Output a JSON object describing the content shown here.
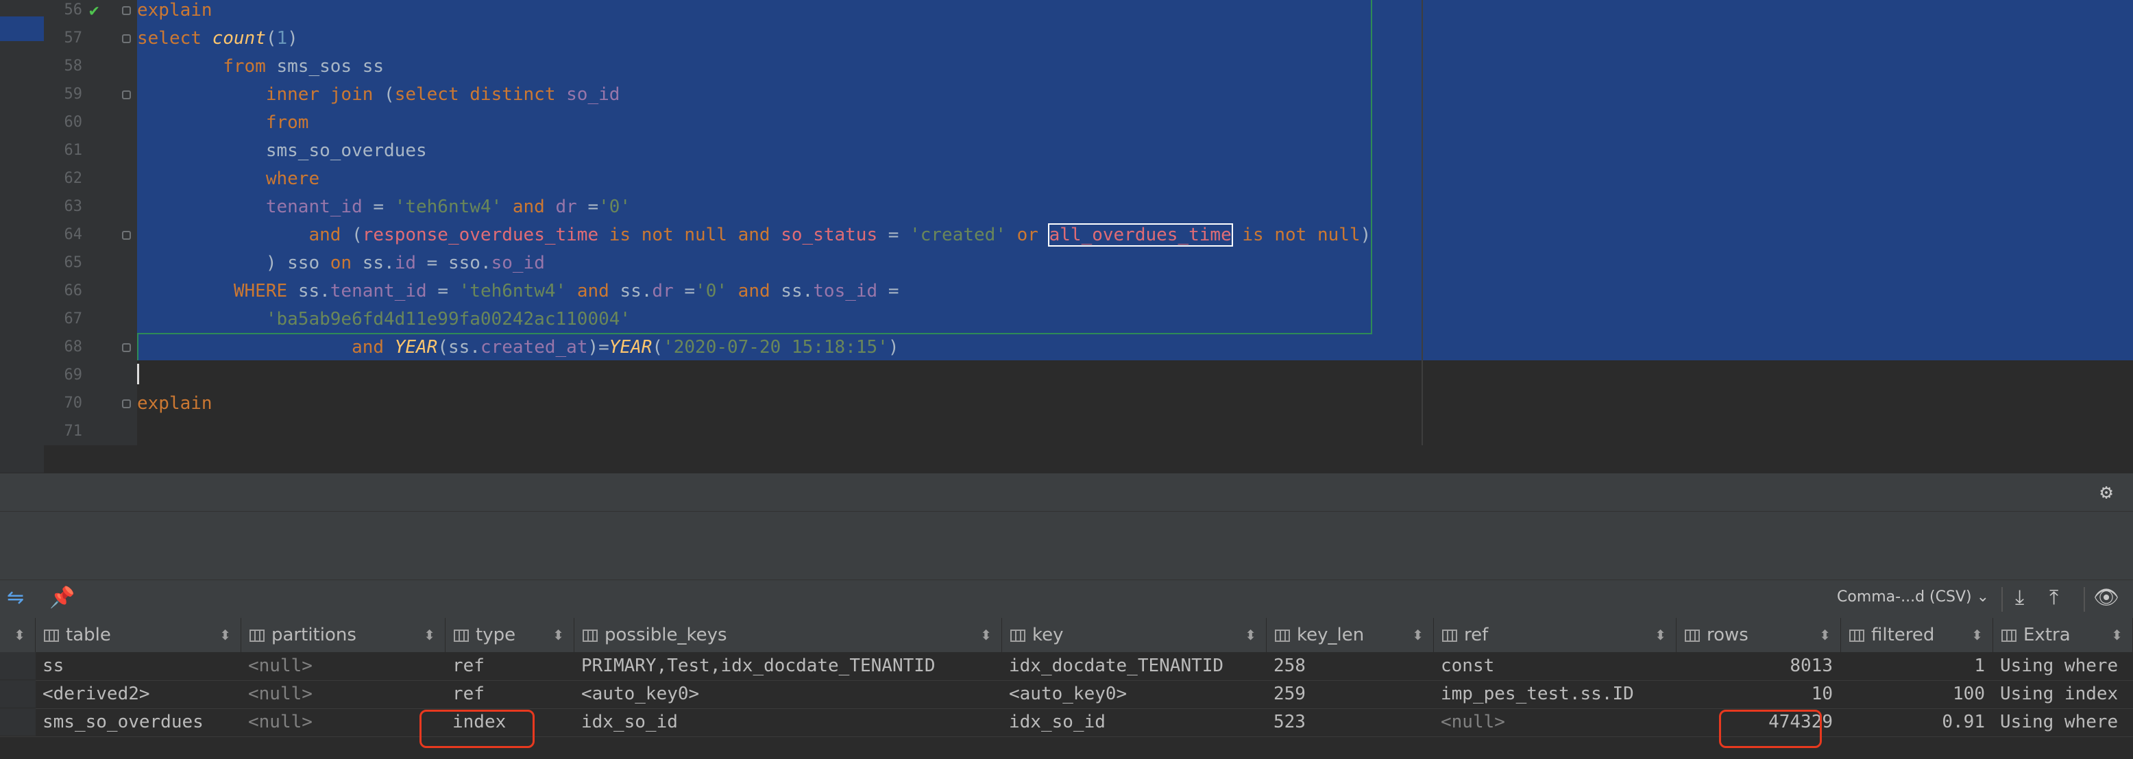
{
  "editor": {
    "line_numbers": [
      "56",
      "57",
      "58",
      "59",
      "60",
      "61",
      "62",
      "63",
      "64",
      "65",
      "66",
      "67",
      "68",
      "69",
      "70",
      "71"
    ],
    "lines": [
      [
        {
          "t": "explain",
          "c": "kw"
        }
      ],
      [
        {
          "t": "select ",
          "c": "kw"
        },
        {
          "t": "count",
          "c": "fn"
        },
        {
          "t": "(",
          "c": "plain"
        },
        {
          "t": "1",
          "c": "num"
        },
        {
          "t": ")",
          "c": "plain"
        }
      ],
      [
        {
          "t": "        from ",
          "c": "kw"
        },
        {
          "t": "sms_sos ss",
          "c": "plain"
        }
      ],
      [
        {
          "t": "            inner join ",
          "c": "kw"
        },
        {
          "t": "(",
          "c": "plain"
        },
        {
          "t": "select distinct ",
          "c": "kw"
        },
        {
          "t": "so_id",
          "c": "col"
        }
      ],
      [
        {
          "t": "            from",
          "c": "kw"
        }
      ],
      [
        {
          "t": "            sms_so_overdues",
          "c": "plain"
        }
      ],
      [
        {
          "t": "            where",
          "c": "kw"
        }
      ],
      [
        {
          "t": "            tenant_id ",
          "c": "col"
        },
        {
          "t": "= ",
          "c": "plain"
        },
        {
          "t": "'teh6ntw4' ",
          "c": "str"
        },
        {
          "t": "and ",
          "c": "kw"
        },
        {
          "t": "dr ",
          "c": "col"
        },
        {
          "t": "=",
          "c": "plain"
        },
        {
          "t": "'0'",
          "c": "str"
        }
      ],
      [
        {
          "t": "                and ",
          "c": "kw"
        },
        {
          "t": "(",
          "c": "plain"
        },
        {
          "t": "response_overdues_time ",
          "c": "err"
        },
        {
          "t": "is not null ",
          "c": "kw"
        },
        {
          "t": "and ",
          "c": "kw"
        },
        {
          "t": "so_status ",
          "c": "err"
        },
        {
          "t": "= ",
          "c": "plain"
        },
        {
          "t": "'created' ",
          "c": "str"
        },
        {
          "t": "or ",
          "c": "kw"
        },
        {
          "t": "all_overdues_time",
          "c": "err boxed"
        },
        {
          "t": " is not null",
          "c": "kw"
        },
        {
          "t": ")",
          "c": "plain"
        }
      ],
      [
        {
          "t": "            ) sso ",
          "c": "plain"
        },
        {
          "t": "on ",
          "c": "kw"
        },
        {
          "t": "ss.",
          "c": "plain"
        },
        {
          "t": "id ",
          "c": "col"
        },
        {
          "t": "= sso.",
          "c": "plain"
        },
        {
          "t": "so_id",
          "c": "col"
        }
      ],
      [
        {
          "t": "         WHERE ",
          "c": "kw"
        },
        {
          "t": "ss.",
          "c": "plain"
        },
        {
          "t": "tenant_id ",
          "c": "col"
        },
        {
          "t": "= ",
          "c": "plain"
        },
        {
          "t": "'teh6ntw4' ",
          "c": "str"
        },
        {
          "t": "and ",
          "c": "kw"
        },
        {
          "t": "ss.",
          "c": "plain"
        },
        {
          "t": "dr ",
          "c": "col"
        },
        {
          "t": "=",
          "c": "plain"
        },
        {
          "t": "'0' ",
          "c": "str"
        },
        {
          "t": "and ",
          "c": "kw"
        },
        {
          "t": "ss.",
          "c": "plain"
        },
        {
          "t": "tos_id ",
          "c": "col"
        },
        {
          "t": "=",
          "c": "plain"
        }
      ],
      [
        {
          "t": "            'ba5ab9e6fd4d11e99fa00242ac110004'",
          "c": "str"
        }
      ],
      [
        {
          "t": "                    and ",
          "c": "kw"
        },
        {
          "t": "YEAR",
          "c": "fn"
        },
        {
          "t": "(ss.",
          "c": "plain"
        },
        {
          "t": "created_at",
          "c": "col"
        },
        {
          "t": ")=",
          "c": "plain"
        },
        {
          "t": "YEAR",
          "c": "fn"
        },
        {
          "t": "(",
          "c": "plain"
        },
        {
          "t": "'2020-07-20 15:18:15'",
          "c": "str"
        },
        {
          "t": ")",
          "c": "plain"
        }
      ],
      [],
      [
        {
          "t": "explain",
          "c": "kw"
        }
      ],
      []
    ]
  },
  "toolbar": {
    "csv_label": "Comma-...d (CSV) ⌄"
  },
  "grid": {
    "columns": [
      {
        "label": "table"
      },
      {
        "label": "partitions"
      },
      {
        "label": "type"
      },
      {
        "label": "possible_keys"
      },
      {
        "label": "key"
      },
      {
        "label": "key_len"
      },
      {
        "label": "ref"
      },
      {
        "label": "rows"
      },
      {
        "label": "filtered"
      },
      {
        "label": "Extra"
      }
    ],
    "rows": [
      [
        "ss",
        "<null>",
        "ref",
        "PRIMARY,Test,idx_docdate_TENANTID",
        "idx_docdate_TENANTID",
        "258",
        "const",
        "8013",
        "1",
        "Using where"
      ],
      [
        "<derived2>",
        "<null>",
        "ref",
        "<auto_key0>",
        "<auto_key0>",
        "259",
        "imp_pes_test.ss.ID",
        "10",
        "100",
        "Using index"
      ],
      [
        "sms_so_overdues",
        "<null>",
        "index",
        "idx_so_id",
        "idx_so_id",
        "523",
        "<null>",
        "474329",
        "0.91",
        "Using where"
      ]
    ]
  },
  "icons": {
    "gutter_ok": "checkmark-icon",
    "settings": "gear-icon",
    "pin": "pin-icon",
    "download": "download-icon",
    "upload": "upload-icon",
    "view": "eye-icon"
  },
  "colors": {
    "selection": "#214283",
    "highlight_box": "#e8391f",
    "keyword": "#cc7832"
  }
}
